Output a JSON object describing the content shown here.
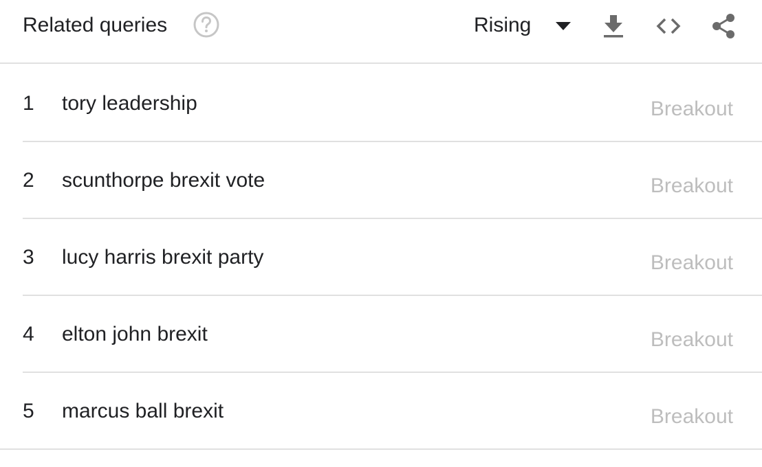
{
  "header": {
    "title": "Related queries",
    "help_icon": "help-circle-icon",
    "sort_select": {
      "selected": "Rising",
      "icon": "caret-down-icon"
    },
    "tools": [
      {
        "name": "download",
        "icon": "download-icon"
      },
      {
        "name": "embed",
        "icon": "code-icon"
      },
      {
        "name": "share",
        "icon": "share-icon"
      }
    ]
  },
  "queries": [
    {
      "rank": "1",
      "query": "tory leadership",
      "value": "Breakout"
    },
    {
      "rank": "2",
      "query": "scunthorpe brexit vote",
      "value": "Breakout"
    },
    {
      "rank": "3",
      "query": "lucy harris brexit party",
      "value": "Breakout"
    },
    {
      "rank": "4",
      "query": "elton john brexit",
      "value": "Breakout"
    },
    {
      "rank": "5",
      "query": "marcus ball brexit",
      "value": "Breakout"
    }
  ],
  "colors": {
    "text": "#202124",
    "muted": "#bdbdbd",
    "icon": "#6b6b6b",
    "divider": "#e0e0e0"
  }
}
